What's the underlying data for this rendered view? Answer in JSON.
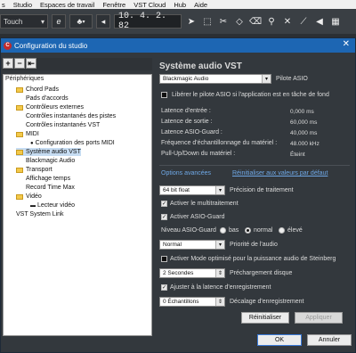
{
  "menubar": {
    "items": [
      "s",
      "Studio",
      "Espaces de travail",
      "Fenêtre",
      "VST Cloud",
      "Hub",
      "Aide"
    ]
  },
  "toolbar": {
    "mode": "Touch",
    "e_label": "e",
    "position": "10. 4. 2. 82"
  },
  "dialog": {
    "title": "Configuration du studio",
    "app_icon_letter": "C",
    "close_glyph": "✕",
    "tree_buttons": [
      "+",
      "−",
      "⇤"
    ],
    "tree_root": "Périphériques",
    "tree": [
      {
        "label": "Chord Pads"
      },
      {
        "label": "Pads d'accords"
      },
      {
        "label": "Contrôleurs externes"
      },
      {
        "label": "Contrôles instantanés des pistes"
      },
      {
        "label": "Contrôles instantanés VST"
      },
      {
        "label": "MIDI"
      },
      {
        "label": "Configuration des ports MIDI"
      },
      {
        "label": "Système audio VST"
      },
      {
        "label": "Blackmagic Audio"
      },
      {
        "label": "Transport"
      },
      {
        "label": "Affichage temps"
      },
      {
        "label": "Record Time Max"
      },
      {
        "label": "Vidéo"
      },
      {
        "label": "Lecteur vidéo"
      },
      {
        "label": "VST System Link"
      }
    ],
    "panel": {
      "title": "Système audio VST",
      "driver": "Blackmagic Audio",
      "driver_label": "Pilote ASIO",
      "release_label": "Libérer le pilote ASIO si l'application est en tâche de fond",
      "stats": [
        {
          "label": "Latence d'entrée :",
          "value": "0,000 ms"
        },
        {
          "label": "Latence de sortie :",
          "value": "60,000 ms"
        },
        {
          "label": "Latence ASIO-Guard :",
          "value": "40,000 ms"
        },
        {
          "label": "Fréquence d'échantillonnage du matériel :",
          "value": "48.000 kHz"
        },
        {
          "label": "Pull-Up/Down du matériel :",
          "value": "Éteint"
        }
      ],
      "advanced_label": "Options avancées",
      "reset_link": "Réinitialiser aux valeurs par défaut",
      "precision_value": "64 bit float",
      "precision_label": "Précision de traitement",
      "multitrait_label": "Activer le multitraitement",
      "asioguard_label": "Activer ASIO-Guard",
      "asioguard_level_label": "Niveau ASIO-Guard",
      "levels": [
        "bas",
        "normal",
        "élevé"
      ],
      "priority_value": "Normal",
      "priority_label": "Priorité de l'audio",
      "steinberg_label": "Activer Mode optimisé pour la puissance audio de Steinberg",
      "preload_value": "2 Secondes",
      "preload_label": "Préchargement disque",
      "adjust_label": "Ajuster à la latence d'enregistrement",
      "offset_value": "0 Échantillons",
      "offset_label": "Décalage d'enregistrement",
      "reset_button": "Réinitialiser",
      "apply_button": "Appliquer"
    },
    "ok_button": "OK",
    "cancel_button": "Annuler"
  }
}
